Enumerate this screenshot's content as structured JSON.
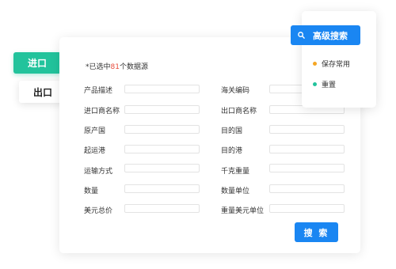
{
  "tabs": [
    {
      "label": "进口",
      "active": true
    },
    {
      "label": "出口",
      "active": false
    }
  ],
  "selected": {
    "prefix": "*已选中",
    "count": "81",
    "suffix": "个数据源"
  },
  "fields": {
    "left": [
      {
        "label": "产品描述",
        "value": ""
      },
      {
        "label": "进口商名称",
        "value": ""
      },
      {
        "label": "原产国",
        "value": ""
      },
      {
        "label": "起运港",
        "value": ""
      },
      {
        "label": "运输方式",
        "value": ""
      },
      {
        "label": "数量",
        "value": ""
      },
      {
        "label": "美元总价",
        "value": ""
      }
    ],
    "right": [
      {
        "label": "海关编码",
        "value": ""
      },
      {
        "label": "出口商名称",
        "value": ""
      },
      {
        "label": "目的国",
        "value": ""
      },
      {
        "label": "目的港",
        "value": ""
      },
      {
        "label": "千克重量",
        "value": ""
      },
      {
        "label": "数量单位",
        "value": ""
      },
      {
        "label": "重量美元单位",
        "value": ""
      }
    ]
  },
  "search_button": "搜 索",
  "advanced": {
    "button": "高级搜索",
    "icon": "search-icon",
    "menu": [
      {
        "label": "保存常用",
        "dot_color": "#f5a623"
      },
      {
        "label": "重置",
        "dot_color": "#22c39c"
      }
    ]
  },
  "colors": {
    "accent": "#1a86f2",
    "tab_active": "#22c39c",
    "count": "#e74c3c"
  }
}
